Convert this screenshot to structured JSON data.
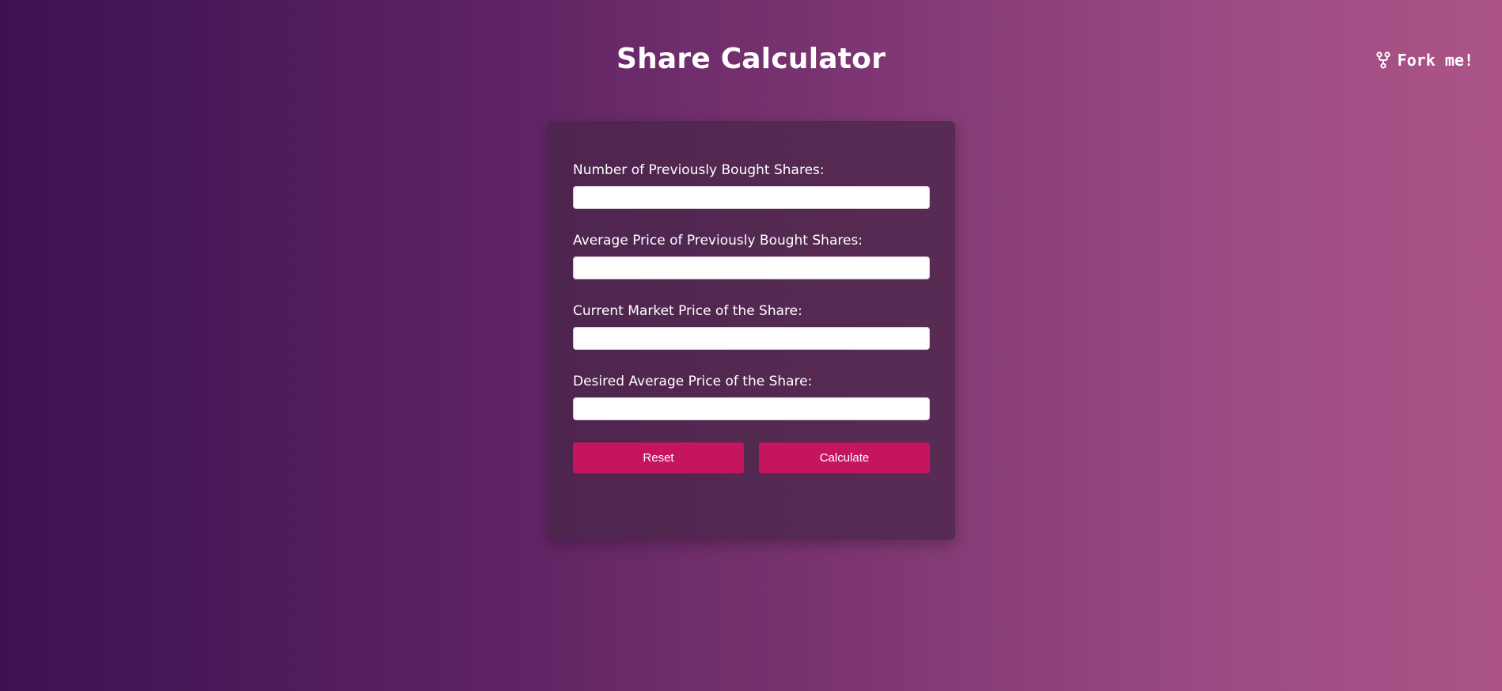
{
  "header": {
    "title": "Share Calculator",
    "fork_label": "Fork me!",
    "fork_icon": "git-fork-icon"
  },
  "form": {
    "fields": [
      {
        "label": "Number of Previously Bought Shares:",
        "value": ""
      },
      {
        "label": "Average Price of Previously Bought Shares:",
        "value": ""
      },
      {
        "label": "Current Market Price of the Share:",
        "value": ""
      },
      {
        "label": "Desired Average Price of the Share:",
        "value": ""
      }
    ],
    "reset_label": "Reset",
    "calculate_label": "Calculate"
  },
  "colors": {
    "accent": "#c5155f",
    "background_start": "#3d1150",
    "background_end": "#ac5488"
  }
}
